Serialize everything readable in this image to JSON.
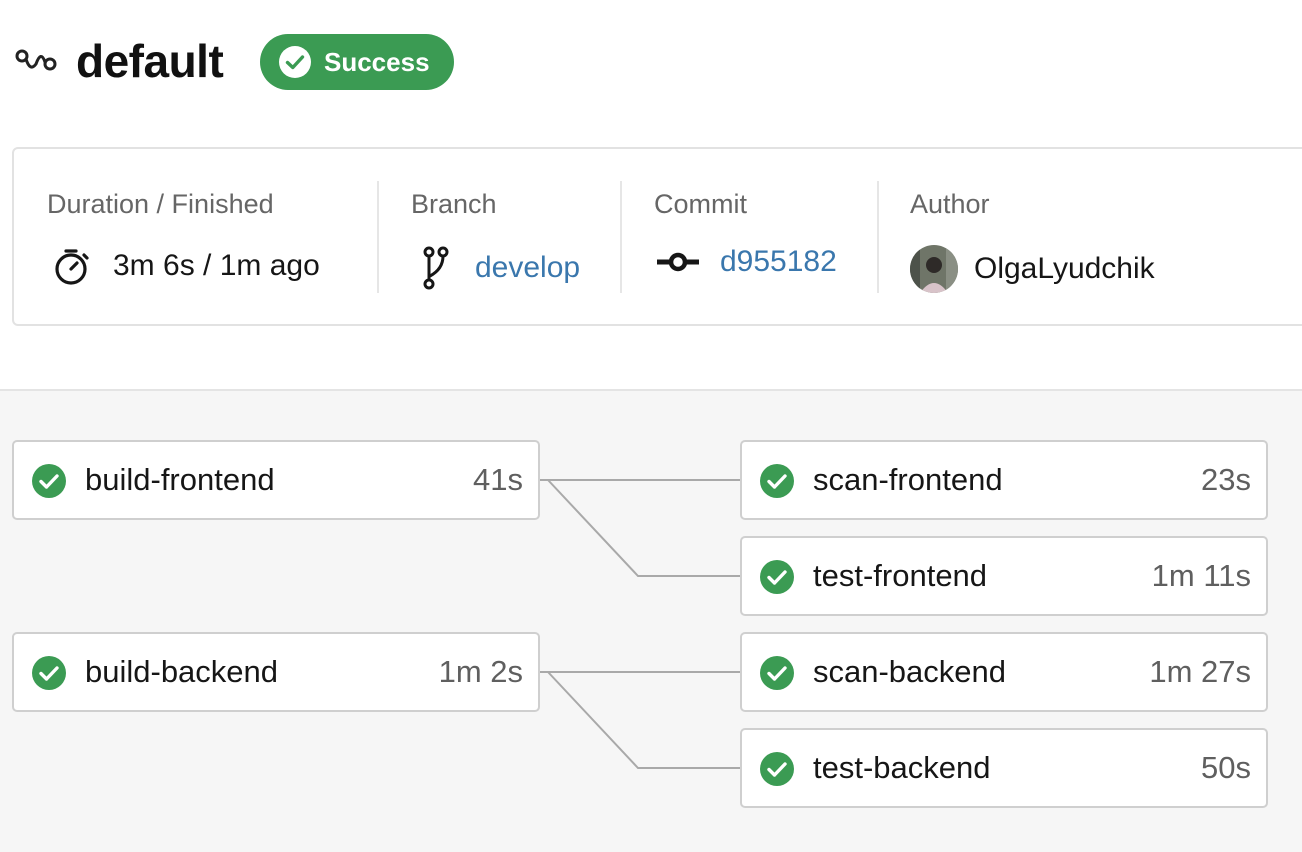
{
  "header": {
    "title": "default",
    "status": "Success",
    "status_color": "#3b9b53"
  },
  "summary": {
    "duration": {
      "label": "Duration / Finished",
      "value": "3m 6s / 1m ago",
      "icon": "stopwatch-icon"
    },
    "branch": {
      "label": "Branch",
      "value": "develop",
      "icon": "branch-icon"
    },
    "commit": {
      "label": "Commit",
      "value": "d955182",
      "icon": "commit-icon"
    },
    "author": {
      "label": "Author",
      "value": "OlgaLyudchik",
      "icon": "avatar"
    }
  },
  "jobs": [
    {
      "name": "build-frontend",
      "duration": "41s",
      "status": "success"
    },
    {
      "name": "scan-frontend",
      "duration": "23s",
      "status": "success"
    },
    {
      "name": "test-frontend",
      "duration": "1m 11s",
      "status": "success"
    },
    {
      "name": "build-backend",
      "duration": "1m 2s",
      "status": "success"
    },
    {
      "name": "scan-backend",
      "duration": "1m 27s",
      "status": "success"
    },
    {
      "name": "test-backend",
      "duration": "50s",
      "status": "success"
    }
  ],
  "colors": {
    "success": "#3b9b53",
    "link": "#3a77ad"
  }
}
